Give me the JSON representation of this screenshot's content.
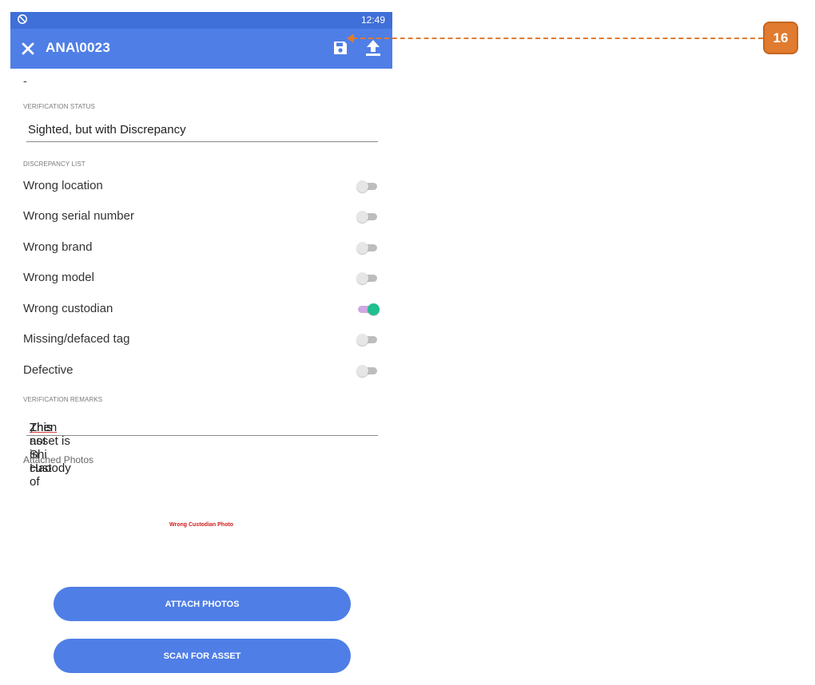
{
  "statusbar": {
    "time": "12:49",
    "sync_icon": "sync-disabled-icon"
  },
  "appbar": {
    "title": "ANA\\0023",
    "close_icon": "close-icon",
    "save_icon": "save-icon",
    "upload_icon": "upload-icon",
    "color": "#4f7ee6"
  },
  "form": {
    "dash": "-",
    "verification_status_label": "VERIFICATION STATUS",
    "verification_status_value": "Sighted, but with Discrepancy",
    "discrepancy_list_label": "DISCREPANCY LIST",
    "discrepancies": [
      {
        "label": "Wrong location",
        "on": false
      },
      {
        "label": "Wrong serial number",
        "on": false
      },
      {
        "label": "Wrong brand",
        "on": false
      },
      {
        "label": "Wrong model",
        "on": false
      },
      {
        "label": "Wrong custodian",
        "on": true
      },
      {
        "label": "Missing/defaced tag",
        "on": false
      },
      {
        "label": "Defective",
        "on": false
      }
    ],
    "remarks_label": "VERIFICATION REMARKS",
    "remarks_value": {
      "part1": "This asset is in custody of ",
      "part2": "Zhen",
      "part3": " ",
      "part4": "Zhi",
      "part5": ", not Shi Hao"
    },
    "attached_photos_label": "Attached Photos",
    "photo_caption": "Wrong Custodian Photo"
  },
  "buttons": {
    "attach_photos": "ATTACH PHOTOS",
    "scan_for_asset": "SCAN FOR ASSET"
  },
  "annotation": {
    "badge": "16",
    "color": "#e07b2f"
  }
}
